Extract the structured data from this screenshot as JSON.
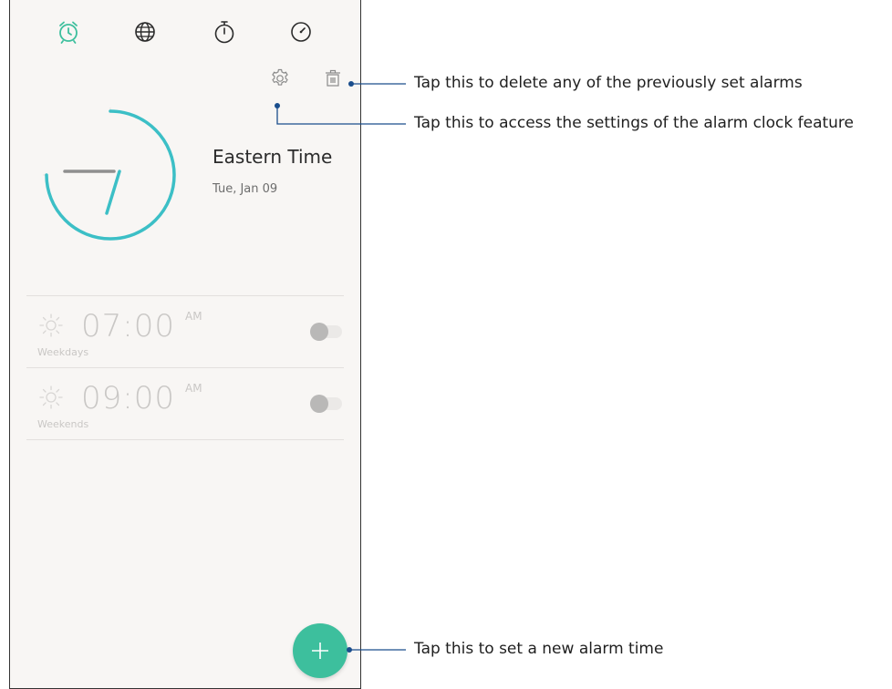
{
  "colors": {
    "accent": "#3dbf9d",
    "clock_ring": "#3cbfc6",
    "callout_line": "#1a4d8c",
    "alarm_inactive": "#c9c7c5"
  },
  "tabs": [
    {
      "id": "alarm",
      "icon": "alarm-clock-icon",
      "active": true
    },
    {
      "id": "world-clock",
      "icon": "globe-icon",
      "active": false
    },
    {
      "id": "stopwatch",
      "icon": "stopwatch-icon",
      "active": false
    },
    {
      "id": "timer",
      "icon": "timer-icon",
      "active": false
    }
  ],
  "toolbar": {
    "settings_icon": "gear-icon",
    "delete_icon": "trash-icon"
  },
  "world_clock": {
    "zone_name": "Eastern Time",
    "date": "Tue, Jan 09"
  },
  "alarms": [
    {
      "time": "07:00",
      "ampm": "AM",
      "days": "Weekdays",
      "enabled": false
    },
    {
      "time": "09:00",
      "ampm": "AM",
      "days": "Weekends",
      "enabled": false
    }
  ],
  "fab": {
    "icon": "plus-icon"
  },
  "callouts": {
    "delete": "Tap this to delete any of the previously set alarms",
    "settings": "Tap this to access the settings of the alarm clock feature",
    "add": "Tap this to set a new alarm time"
  }
}
